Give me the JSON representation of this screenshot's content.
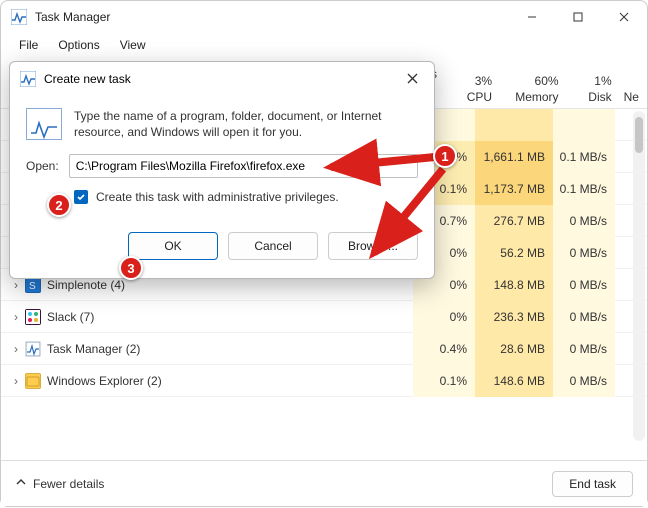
{
  "window": {
    "title": "Task Manager",
    "menu": {
      "file": "File",
      "options": "Options",
      "view": "View"
    }
  },
  "columns": {
    "status_letter": "s",
    "cpu_pct": "3%",
    "cpu_label": "CPU",
    "mem_pct": "60%",
    "mem_label": "Memory",
    "disk_pct": "1%",
    "disk_label": "Disk",
    "net_label": "Ne"
  },
  "rows": [
    {
      "name": "",
      "cpu": "",
      "mem": "",
      "disk": ""
    },
    {
      "name": "",
      "cpu": "0.8%",
      "mem": "1,661.1 MB",
      "disk": "0.1 MB/s"
    },
    {
      "name": "",
      "cpu": "0.1%",
      "mem": "1,173.7 MB",
      "disk": "0.1 MB/s"
    },
    {
      "name": "",
      "cpu": "0.7%",
      "mem": "276.7 MB",
      "disk": "0 MB/s"
    },
    {
      "name": "",
      "cpu": "0%",
      "mem": "56.2 MB",
      "disk": "0 MB/s"
    },
    {
      "name": "Simplenote (4)",
      "icon": "#2079d6",
      "cpu": "0%",
      "mem": "148.8 MB",
      "disk": "0 MB/s"
    },
    {
      "name": "Slack (7)",
      "icon": "#4a154b",
      "cpu": "0%",
      "mem": "236.3 MB",
      "disk": "0 MB/s"
    },
    {
      "name": "Task Manager (2)",
      "icon": "#fff",
      "cpu": "0.4%",
      "mem": "28.6 MB",
      "disk": "0 MB/s"
    },
    {
      "name": "Windows Explorer (2)",
      "icon": "#ffcc4d",
      "cpu": "0.1%",
      "mem": "148.6 MB",
      "disk": "0 MB/s"
    }
  ],
  "footer": {
    "fewer": "Fewer details",
    "end": "End task"
  },
  "dialog": {
    "title": "Create new task",
    "desc": "Type the name of a program, folder, document, or Internet resource, and Windows will open it for you.",
    "open_label": "Open:",
    "open_value": "C:\\Program Files\\Mozilla Firefox\\firefox.exe",
    "checkbox_label": "Create this task with administrative privileges.",
    "ok": "OK",
    "cancel": "Cancel",
    "browse": "Browse..."
  },
  "callouts": {
    "c1": "1",
    "c2": "2",
    "c3": "3"
  }
}
